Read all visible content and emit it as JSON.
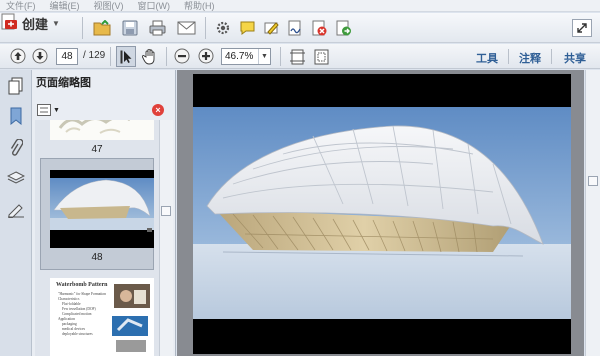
{
  "menu": [
    "文件(F)",
    "编辑(E)",
    "视图(V)",
    "窗口(W)",
    "帮助(H)"
  ],
  "toolbar": {
    "create_label": "创建",
    "icons": [
      "open-folder-icon",
      "save-icon",
      "print-icon",
      "email-icon",
      "gear-icon",
      "comment-icon",
      "highlight-icon",
      "sign-icon",
      "redact-icon",
      "export-icon"
    ]
  },
  "nav": {
    "page_number": "48",
    "page_total": "/ 129",
    "zoom": "46.7%",
    "right_links": [
      "工具",
      "注释",
      "共享"
    ]
  },
  "thumbnails": {
    "title": "页面缩略图",
    "pages": [
      {
        "number": "47",
        "selected": false
      },
      {
        "number": "48",
        "selected": true
      },
      {
        "number": "49",
        "selected": false
      }
    ],
    "slide49": {
      "heading": "Waterbomb Pattern",
      "bullets": [
        "\"Harmonic\" for Shape Formation",
        "Characteristics",
        "Flat-foldable",
        "Few tessellation (DOF)",
        "Complicated motion",
        "Application",
        "packaging",
        "medical devices",
        "deployable structures"
      ]
    }
  },
  "colors": {
    "sky_top": "#5f8cc4",
    "sky_bottom": "#a9c3de",
    "ground": "#c8d6e6",
    "shell_white": "#eef0f3",
    "shell_inner": "#cbb98f"
  }
}
